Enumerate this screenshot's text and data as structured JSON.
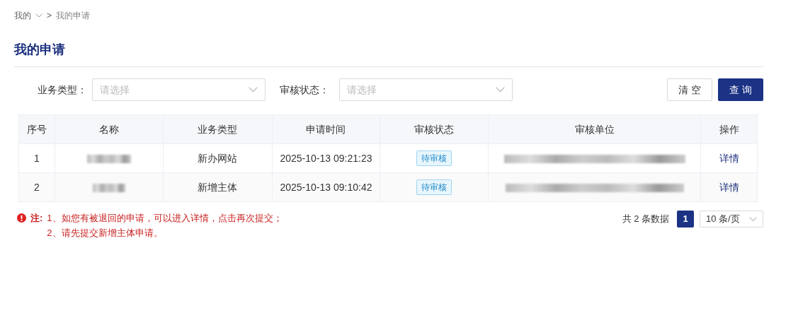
{
  "breadcrumb": {
    "items": [
      {
        "label": "我的",
        "dropdown": true
      },
      {
        "label": "我的申请",
        "dropdown": false
      }
    ],
    "separator": ">"
  },
  "page_title": "我的申请",
  "filters": [
    {
      "label": "业务类型：",
      "placeholder": "请选择"
    },
    {
      "label": "审核状态：",
      "placeholder": "请选择"
    }
  ],
  "buttons": [
    {
      "label": "清 空",
      "kind": "secondary"
    },
    {
      "label": "查 询",
      "kind": "primary"
    }
  ],
  "table": {
    "columns": [
      "序号",
      "名称",
      "业务类型",
      "申请时间",
      "审核状态",
      "审核单位",
      "操作"
    ],
    "rows": [
      {
        "index": "1",
        "business_type": "新办网站",
        "time": "2025-10-13 09:21:23",
        "status": "待审核",
        "action": "详情"
      },
      {
        "index": "2",
        "business_type": "新增主体",
        "time": "2025-10-13 09:10:42",
        "status": "待审核",
        "action": "详情"
      }
    ]
  },
  "note": {
    "label": "注:",
    "lines": [
      "1、如您有被退回的申请，可以进入详情，点击再次提交；",
      "2、请先提交新增主体申请。"
    ]
  },
  "pagination": {
    "total": "共 2 条数据",
    "pages": [
      {
        "label": "1",
        "selected": true
      }
    ],
    "page_size": "10 条/页"
  }
}
